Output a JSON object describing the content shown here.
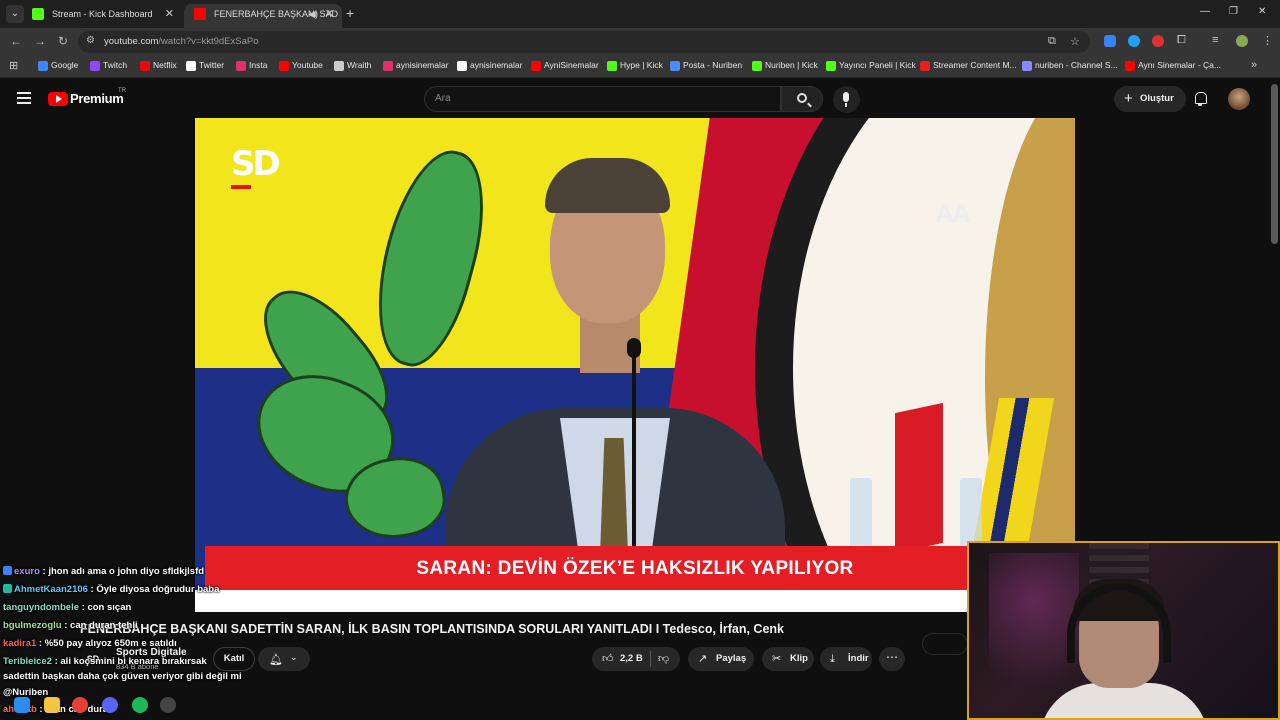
{
  "browser": {
    "tabs": [
      {
        "title": "Stream - Kick Dashboard",
        "favicon_color": "#53fc18",
        "active": false
      },
      {
        "title": "FENERBAHÇE BAŞKANI SAD",
        "favicon_color": "#ff0000",
        "active": true
      }
    ],
    "url": "youtube.com",
    "url_path": "/watch?v=kkt9dExSaPo",
    "bookmarks": [
      {
        "label": "Google",
        "color": "#4285f4"
      },
      {
        "label": "Twitch",
        "color": "#9146ff"
      },
      {
        "label": "Netflix",
        "color": "#e50914"
      },
      {
        "label": "Twitter",
        "color": "#ffffff"
      },
      {
        "label": "Insta",
        "color": "#e1306c"
      },
      {
        "label": "Youtube",
        "color": "#ff0000"
      },
      {
        "label": "Wraith",
        "color": "#cccccc"
      },
      {
        "label": "aynisinemalar",
        "color": "#e1306c"
      },
      {
        "label": "aynisinemalar",
        "color": "#ffffff"
      },
      {
        "label": "AyniSinemalar",
        "color": "#ff0000"
      },
      {
        "label": "Hype | Kick",
        "color": "#53fc18"
      },
      {
        "label": "Posta - Nuriben",
        "color": "#4c8bf5"
      },
      {
        "label": "Nuriben | Kick",
        "color": "#53fc18"
      },
      {
        "label": "Yayıncı Paneli | Kick",
        "color": "#53fc18"
      },
      {
        "label": "Streamer Content M...",
        "color": "#e31e24"
      },
      {
        "label": "nuriben - Channel S...",
        "color": "#8888ff"
      },
      {
        "label": "Aynı Sinemalar - Ça...",
        "color": "#ff0000"
      }
    ]
  },
  "youtube": {
    "brand": "Premium",
    "region": "TR",
    "search_placeholder": "Ara",
    "create_label": "Oluştur"
  },
  "video": {
    "banner": "SARAN: DEVİN ÖZEK’E HAKSIZLIK YAPILIYOR",
    "sd_logo": "SD",
    "aa_logo": "AA",
    "title": "FENERBAHÇE BAŞKANI SADETTİN SARAN, İLK BASIN TOPLANTISINDA SORULARI YANITLADI I Tedesco, İrfan, Cenk",
    "channel_name": "Sports Digitale",
    "channel_subs": "834 B abone",
    "join_label": "Katıl",
    "likes": "2,2 B",
    "share_label": "Paylaş",
    "clip_label": "Klip",
    "download_label": "İndir"
  },
  "chat": [
    {
      "user": "exuro",
      "msg": "jhon adı ama o john diyo sfldkjlsfd",
      "color": "#a98bff",
      "badge": "#3b82f6"
    },
    {
      "user": "AhmetKaan2106",
      "msg": "Öyle diyosa doğrudur baba",
      "color": "#5ac8fa",
      "badge": "#1fb9a3"
    },
    {
      "user": "tanguyndombele",
      "msg": "con sıçan",
      "color": "#7fe0c3",
      "badge": ""
    },
    {
      "user": "bgulmezoglu",
      "msg": "can duran tehli",
      "color": "#9be38c",
      "badge": ""
    },
    {
      "user": "kadira1",
      "msg": "%50 pay alıyoz 650m e satıldı",
      "color": "#ff5b5b",
      "badge": ""
    },
    {
      "user": "Teribleice2",
      "msg": "ali koçsmini bi kenara bırakırsak",
      "color": "#7fe0c3",
      "badge": ""
    },
    {
      "user": "",
      "msg": "sadettin başkan daha çok güven veriyor gibi değil mi",
      "color": "#ffffff",
      "badge": ""
    },
    {
      "user": "",
      "msg": "@Nuriben",
      "color": "#ffffff",
      "badge": ""
    },
    {
      "user": "ahmetb",
      "msg": "irfan can duran",
      "color": "#ff5b5b",
      "badge": ""
    }
  ]
}
